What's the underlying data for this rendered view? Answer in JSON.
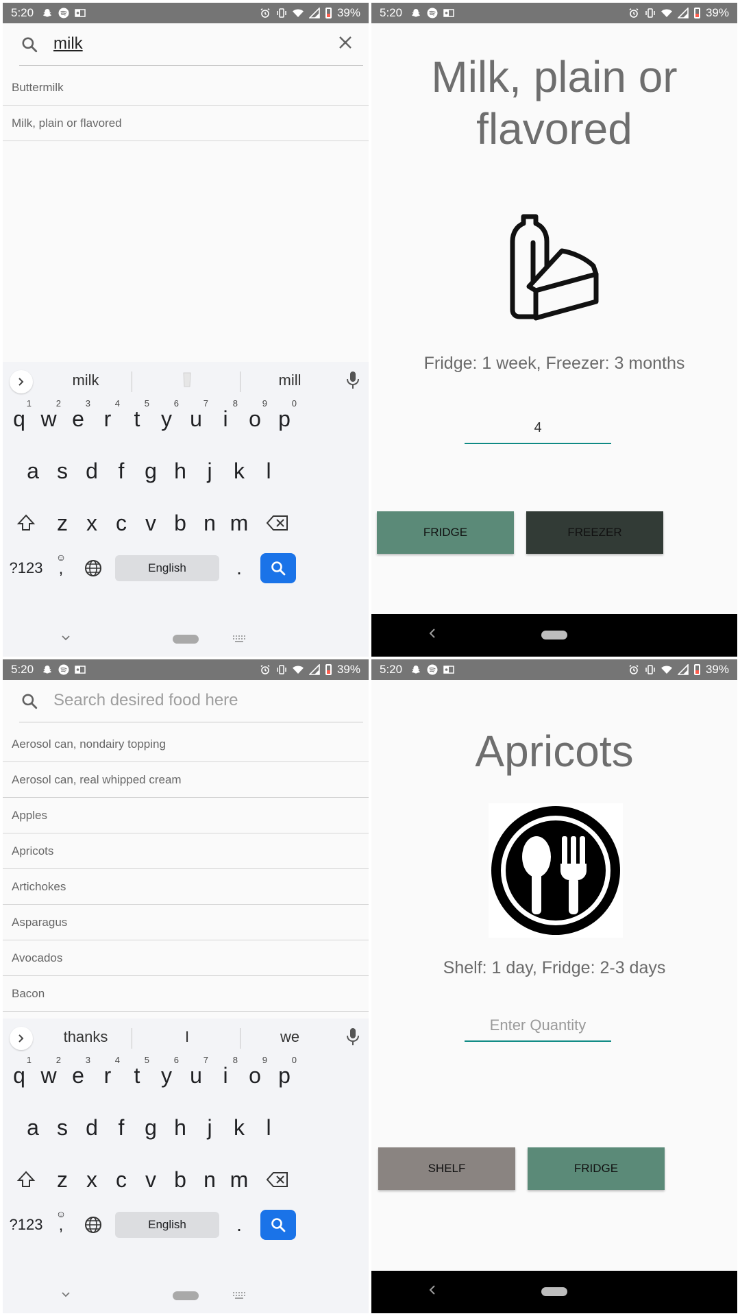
{
  "status_bar": {
    "time": "5:20",
    "battery": "39%"
  },
  "colors": {
    "accent": "#0f8a84",
    "fridge": "#5b8a78",
    "freezer": "#323b36",
    "shelf": "#8a8481",
    "status_bar": "#757575",
    "keyboard_enter": "#1a73e8"
  },
  "screen1": {
    "search": {
      "query": "milk"
    },
    "results": [
      {
        "label": "Buttermilk"
      },
      {
        "label": "Milk, plain or flavored"
      }
    ],
    "keyboard": {
      "suggestions": [
        "milk",
        "",
        "mill"
      ],
      "row1": [
        {
          "k": "q",
          "n": "1"
        },
        {
          "k": "w",
          "n": "2"
        },
        {
          "k": "e",
          "n": "3"
        },
        {
          "k": "r",
          "n": "4"
        },
        {
          "k": "t",
          "n": "5"
        },
        {
          "k": "y",
          "n": "6"
        },
        {
          "k": "u",
          "n": "7"
        },
        {
          "k": "i",
          "n": "8"
        },
        {
          "k": "o",
          "n": "9"
        },
        {
          "k": "p",
          "n": "0"
        }
      ],
      "row2": [
        "a",
        "s",
        "d",
        "f",
        "g",
        "h",
        "j",
        "k",
        "l"
      ],
      "row3": [
        "z",
        "x",
        "c",
        "v",
        "b",
        "n",
        "m"
      ],
      "symbols_label": "?123",
      "comma": ",",
      "period": ".",
      "space_label": "English"
    }
  },
  "screen2": {
    "title": "Milk, plain or flavored",
    "icon": "milk-cheese-icon",
    "storage": "Fridge: 1 week, Freezer: 3 months",
    "quantity_value": "4",
    "buttons": {
      "left": "FRIDGE",
      "right": "FREEZER"
    }
  },
  "screen3": {
    "search": {
      "placeholder": "Search desired food here"
    },
    "results": [
      {
        "label": "Aerosol can, nondairy topping"
      },
      {
        "label": "Aerosol can, real whipped cream"
      },
      {
        "label": "Apples"
      },
      {
        "label": "Apricots"
      },
      {
        "label": "Artichokes"
      },
      {
        "label": "Asparagus"
      },
      {
        "label": "Avocados"
      },
      {
        "label": "Bacon"
      }
    ],
    "keyboard": {
      "suggestions": [
        "thanks",
        "I",
        "we"
      ],
      "row1": [
        {
          "k": "q",
          "n": "1"
        },
        {
          "k": "w",
          "n": "2"
        },
        {
          "k": "e",
          "n": "3"
        },
        {
          "k": "r",
          "n": "4"
        },
        {
          "k": "t",
          "n": "5"
        },
        {
          "k": "y",
          "n": "6"
        },
        {
          "k": "u",
          "n": "7"
        },
        {
          "k": "i",
          "n": "8"
        },
        {
          "k": "o",
          "n": "9"
        },
        {
          "k": "p",
          "n": "0"
        }
      ],
      "row2": [
        "a",
        "s",
        "d",
        "f",
        "g",
        "h",
        "j",
        "k",
        "l"
      ],
      "row3": [
        "z",
        "x",
        "c",
        "v",
        "b",
        "n",
        "m"
      ],
      "symbols_label": "?123",
      "comma": ",",
      "period": ".",
      "space_label": "English"
    }
  },
  "screen4": {
    "title": "Apricots",
    "icon": "utensils-plate-icon",
    "storage": "Shelf: 1 day, Fridge: 2-3 days",
    "quantity_placeholder": "Enter Quantity",
    "buttons": {
      "left": "SHELF",
      "right": "FRIDGE"
    }
  }
}
